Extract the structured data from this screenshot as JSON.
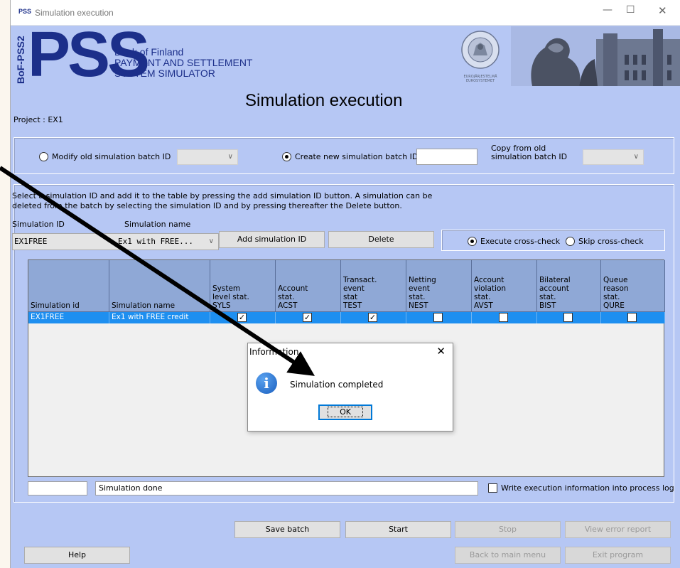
{
  "window": {
    "app_icon_text": "PSS",
    "title": "Simulation execution",
    "controls": {
      "minimize": "—",
      "maximize": "☐",
      "close": "✕"
    }
  },
  "header": {
    "logo_side_text": "BoF-PSS2",
    "logo_letters": "PSS",
    "brand_line1": "Bank of Finland",
    "brand_line2": "PAYMENT AND SETTLEMENT",
    "brand_line3": "SYSTEM SIMULATOR",
    "seal_text_top": "SUOMEN PANKKI",
    "seal_text_bottom": "FINLANDS BANK",
    "seal_caption1": "EUROJÄRJESTELMÄ",
    "seal_caption2": "EUROSYSTEMET",
    "page_title": "Simulation execution"
  },
  "project": {
    "label": "Project : EX1"
  },
  "batch": {
    "modify_label": "Modify old simulation batch ID",
    "modify_selected": false,
    "create_label": "Create new simulation batch ID",
    "create_selected": true,
    "new_batch_id": "",
    "copy_label_line1": "Copy from old",
    "copy_label_line2": "simulation batch ID"
  },
  "simulation": {
    "instructions_line1": "Select a simulation ID and add it to the table by pressing the add simulation ID button. A simulation can be",
    "instructions_line2": "deleted from the batch by selecting the simulation ID and by pressing thereafter the Delete button.",
    "id_label": "Simulation ID",
    "name_label": "Simulation name",
    "id_value": "EX1FREE",
    "name_value": "Ex1 with FREE...",
    "add_button": "Add simulation ID",
    "delete_button": "Delete",
    "execute_crosscheck": "Execute cross-check",
    "skip_crosscheck": "Skip cross-check"
  },
  "table": {
    "columns": [
      {
        "lines": [
          "Simulation id"
        ]
      },
      {
        "lines": [
          "Simulation name"
        ]
      },
      {
        "lines": [
          "System",
          "level stat.",
          "SYLS"
        ]
      },
      {
        "lines": [
          "Account",
          "stat.",
          "ACST"
        ]
      },
      {
        "lines": [
          "Transact.",
          "event",
          "stat",
          "TEST"
        ]
      },
      {
        "lines": [
          "Netting",
          "event",
          "stat.",
          "NEST"
        ]
      },
      {
        "lines": [
          "Account",
          "violation",
          "stat.",
          "AVST"
        ]
      },
      {
        "lines": [
          "Bilateral",
          "account",
          "stat.",
          "BIST"
        ]
      },
      {
        "lines": [
          "Queue",
          "reason",
          "stat.",
          "QURE"
        ]
      }
    ],
    "rows": [
      {
        "id": "EX1FREE",
        "name": "Ex1 with FREE credit",
        "checks": [
          true,
          true,
          true,
          false,
          false,
          false,
          false
        ]
      }
    ]
  },
  "status": {
    "left_value": "",
    "message": "Simulation done",
    "log_label": "Write execution information into process log"
  },
  "buttons": {
    "save_batch": "Save batch",
    "start": "Start",
    "stop": "Stop",
    "view_error": "View error report",
    "help": "Help",
    "back": "Back to main menu",
    "exit": "Exit program"
  },
  "dialog": {
    "title": "Information",
    "close": "✕",
    "icon": "i",
    "message": "Simulation completed",
    "ok": "OK"
  },
  "colors": {
    "window_bg": "#b6c7f4",
    "header_blue": "#1c2f8a",
    "selected_row": "#1e8ff0",
    "table_header": "#8fa8d6"
  }
}
